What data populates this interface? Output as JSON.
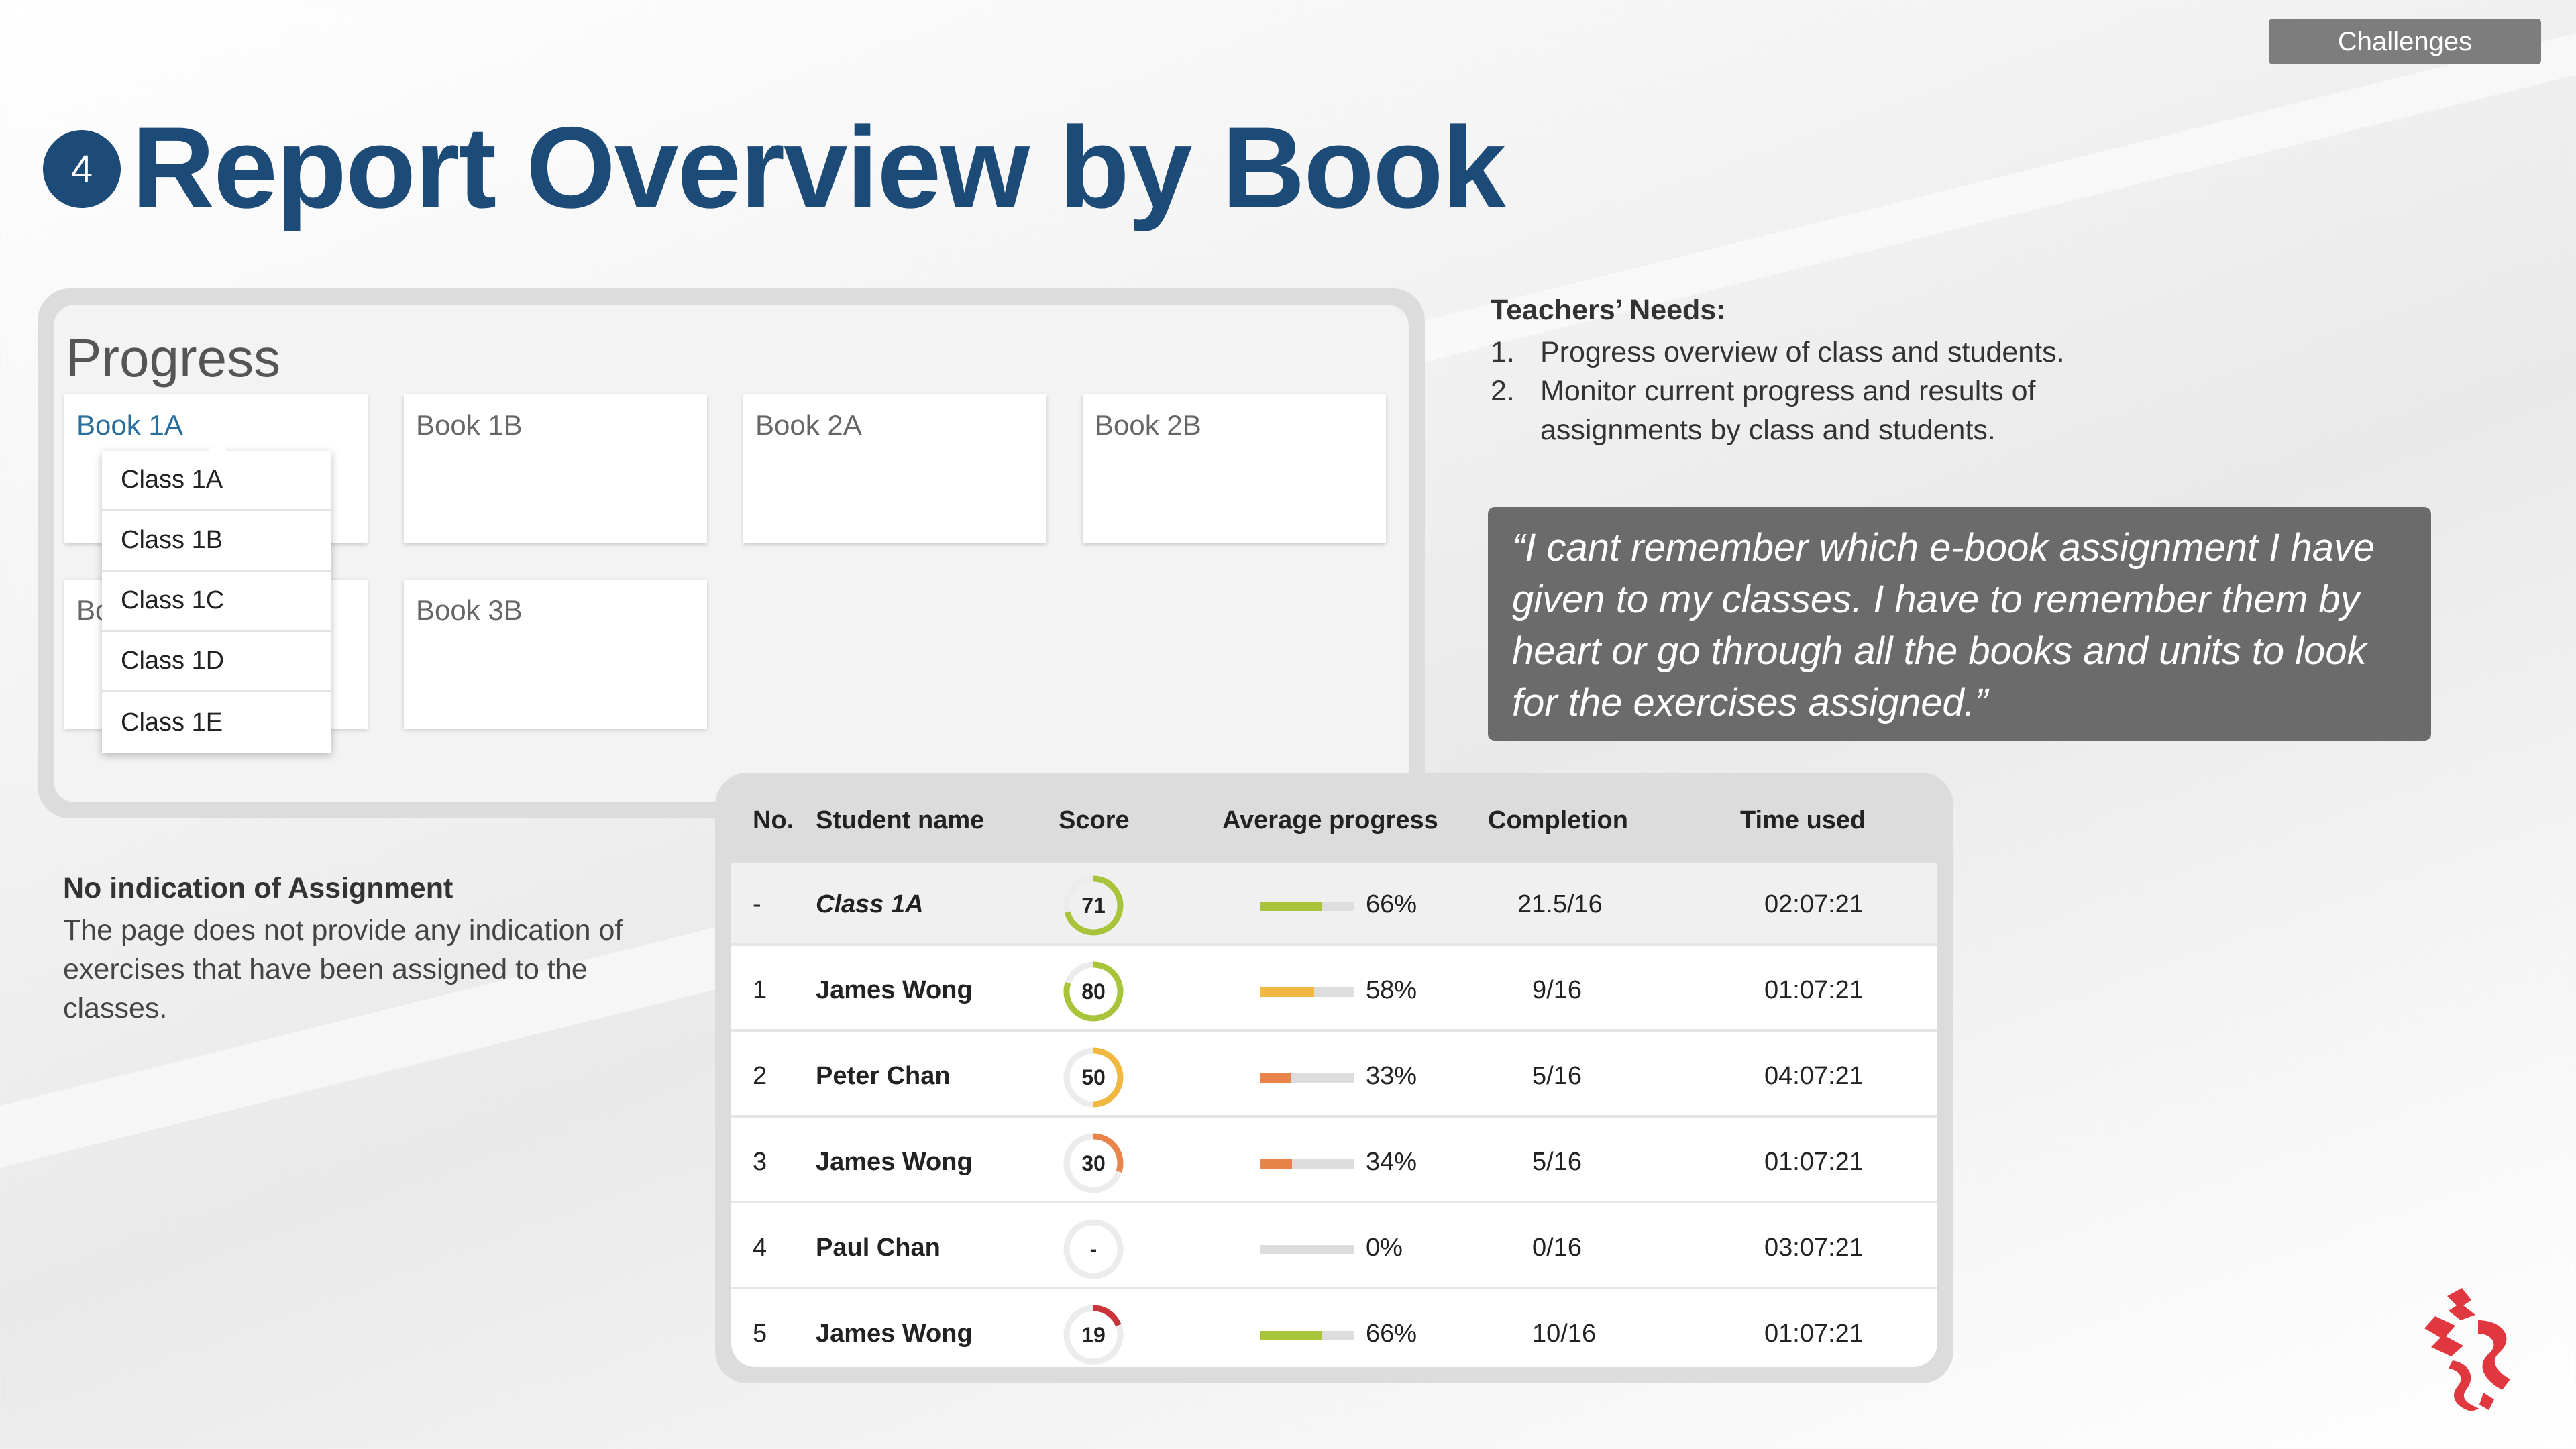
{
  "tag": "Challenges",
  "step_number": "4",
  "title": "Report Overview by Book",
  "progress": {
    "title": "Progress",
    "books": [
      "Book 1A",
      "Book 1B",
      "Book 2A",
      "Book 2B",
      "Bo",
      "Book 3B"
    ],
    "dropdown": [
      "Class 1A",
      "Class 1B",
      "Class 1C",
      "Class 1D",
      "Class 1E"
    ]
  },
  "note": {
    "heading": "No indication of Assignment",
    "body": "The page does not provide any indication of exercises that have been assigned to the classes."
  },
  "needs": {
    "heading": "Teachers’ Needs:",
    "items": [
      {
        "num": "1.",
        "text": "Progress overview of class and students."
      },
      {
        "num": "2.",
        "text": "Monitor current progress and results of assignments by class and students."
      }
    ]
  },
  "quote": "“I cant remember which e-book assignment I have given to my classes. I have to remember them by heart or go through all the books and units to look for the exercises assigned.”",
  "table": {
    "headers": [
      "No.",
      "Student name",
      "Score",
      "Average progress",
      "Completion",
      "Time used"
    ],
    "rows": [
      {
        "no": "-",
        "name": "Class 1A",
        "score": "71",
        "score_value": 71,
        "score_color": "#a8c43a",
        "progress": "66%",
        "progress_value": 0.66,
        "progress_color": "#a8c43a",
        "completion": "21.5/16",
        "time": "02:07:21"
      },
      {
        "no": "1",
        "name": "James Wong",
        "score": "80",
        "score_value": 80,
        "score_color": "#a8c43a",
        "progress": "58%",
        "progress_value": 0.58,
        "progress_color": "#f0b840",
        "completion": "9/16",
        "time": "01:07:21"
      },
      {
        "no": "2",
        "name": "Peter Chan",
        "score": "50",
        "score_value": 50,
        "score_color": "#f0b840",
        "progress": "33%",
        "progress_value": 0.33,
        "progress_color": "#e8834a",
        "completion": "5/16",
        "time": "04:07:21"
      },
      {
        "no": "3",
        "name": "James Wong",
        "score": "30",
        "score_value": 30,
        "score_color": "#e8834a",
        "progress": "34%",
        "progress_value": 0.34,
        "progress_color": "#e8834a",
        "completion": "5/16",
        "time": "01:07:21"
      },
      {
        "no": "4",
        "name": "Paul Chan",
        "score": "-",
        "score_value": 0,
        "score_color": "#e0e0e0",
        "progress": "0%",
        "progress_value": 0,
        "progress_color": "#dddddd",
        "completion": "0/16",
        "time": "03:07:21"
      },
      {
        "no": "5",
        "name": "James Wong",
        "score": "19",
        "score_value": 19,
        "score_color": "#c9333a",
        "progress": "66%",
        "progress_value": 0.66,
        "progress_color": "#a8c43a",
        "completion": "10/16",
        "time": "01:07:21"
      }
    ]
  },
  "colors": {
    "brand": "#1d4b78",
    "tag": "#7d7d7d",
    "quote_bg": "#6b6b6b",
    "logo": "#e0383e"
  }
}
